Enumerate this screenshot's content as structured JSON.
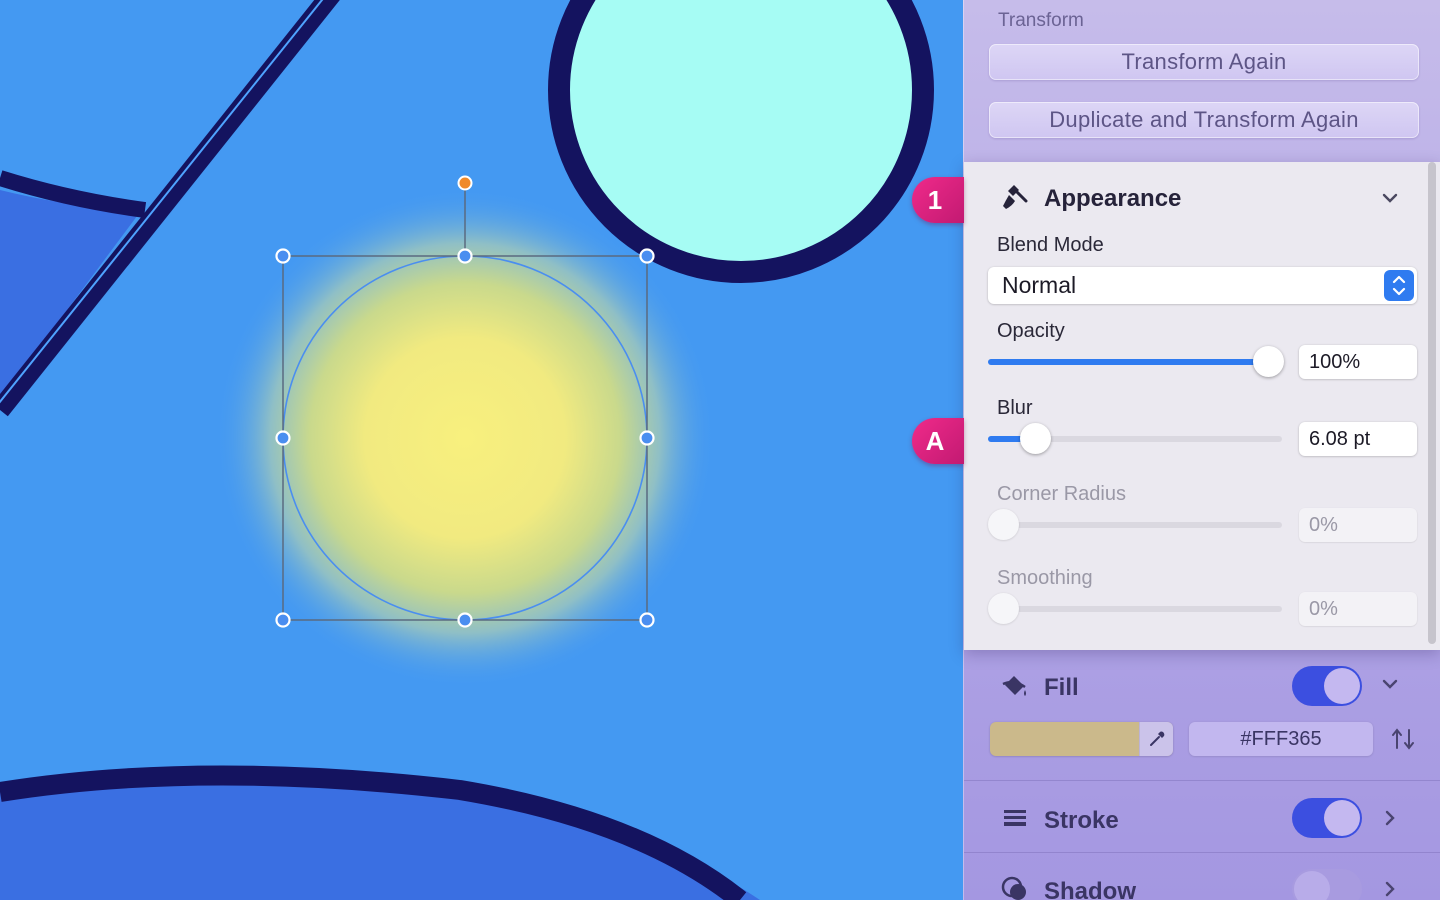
{
  "colors": {
    "canvas_bg": "#4499F2",
    "accent": "#2F7BF0",
    "badge": "#E0207F",
    "fill_hex": "#FFF365"
  },
  "transform": {
    "title": "Transform",
    "transform_again": "Transform Again",
    "duplicate_transform_again": "Duplicate and Transform Again"
  },
  "appearance": {
    "title": "Appearance",
    "icon": "brush-icon",
    "blend_mode_label": "Blend Mode",
    "blend_mode_value": "Normal",
    "opacity_label": "Opacity",
    "opacity_value": "100%",
    "opacity_level": 1.0,
    "blur_label": "Blur",
    "blur_value": "6.08 pt",
    "blur_level": 0.16,
    "corner_radius_label": "Corner Radius",
    "corner_radius_value": "0%",
    "smoothing_label": "Smoothing",
    "smoothing_value": "0%"
  },
  "fill": {
    "title": "Fill",
    "icon": "paint-bucket-icon",
    "enabled": true,
    "hex": "#FFF365"
  },
  "stroke": {
    "title": "Stroke",
    "icon": "lines-icon",
    "enabled": true
  },
  "shadow": {
    "title": "Shadow",
    "icon": "shadow-icon",
    "enabled": false
  },
  "badges": {
    "one": "1",
    "a": "A"
  }
}
